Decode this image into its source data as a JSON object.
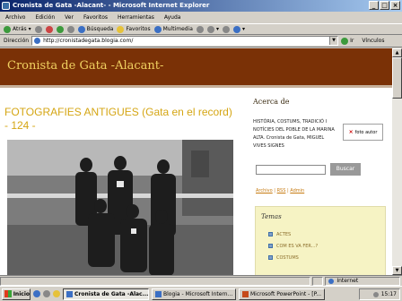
{
  "window": {
    "title": "Cronista de Gata -Alacant- - Microsoft Internet Explorer"
  },
  "menu": [
    "Archivo",
    "Edición",
    "Ver",
    "Favoritos",
    "Herramientas",
    "Ayuda"
  ],
  "toolbar": {
    "back": "Atrás",
    "search": "Búsqueda",
    "favorites": "Favoritos",
    "multimedia": "Multimedia"
  },
  "address": {
    "label": "Dirección",
    "url": "http://cronistadegata.blogia.com/",
    "go": "Ir",
    "links": "Vínculos"
  },
  "blog": {
    "title": "Cronista de Gata -Alacant-"
  },
  "post": {
    "title": "FOTOGRAFIES ANTIGUES (Gata en el record) - 124 -"
  },
  "sidebar": {
    "heading": "Acerca de",
    "profile": "HISTÒRIA, COSTUMS, TRADICIÓ I NOTÍCIES DEL POBLE DE LA MARINA ALTA. Cronista de Gata, MIGUEL VIVES SIGNES",
    "photo_label": "foto autor",
    "search_button": "Buscar",
    "links": {
      "archivo": "Archivo",
      "rss": "RSS",
      "admin": "Admin"
    },
    "temas_title": "Temas",
    "temas": [
      "ACTES",
      "COM ES VA FER...?",
      "COSTUMS"
    ]
  },
  "status": {
    "zone": "Internet"
  },
  "taskbar": {
    "start": "Inicio",
    "items": [
      "Cronista de Gata -Alac...",
      "Blogia - Microsoft Intern...",
      "Microsoft PowerPoint - [P..."
    ],
    "clock": "15:17"
  }
}
